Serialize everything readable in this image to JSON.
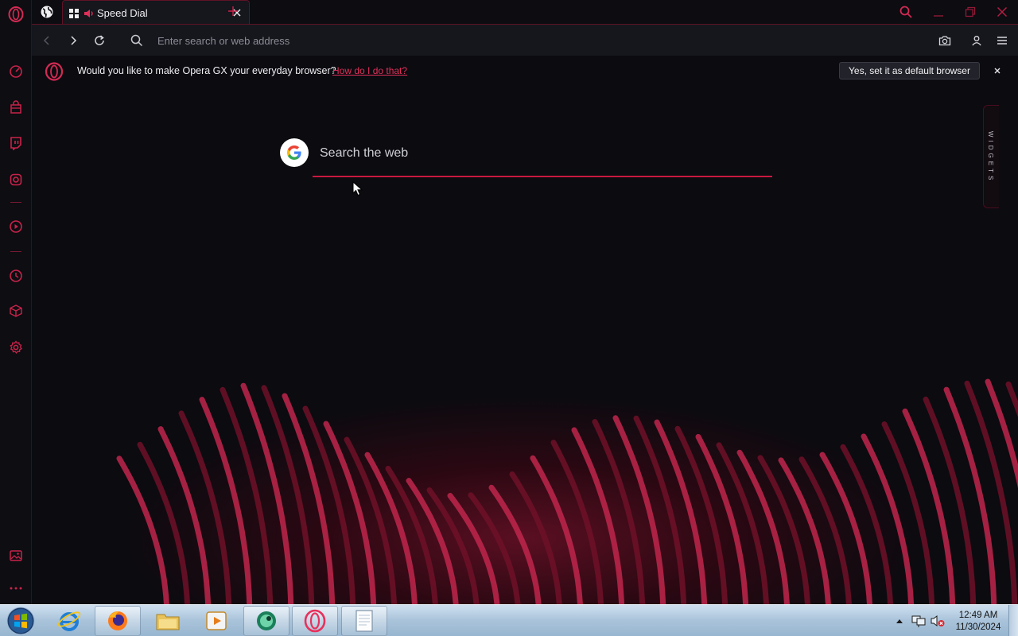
{
  "browser": {
    "tab": {
      "title": "Speed Dial"
    },
    "address_bar": {
      "placeholder": "Enter search or web address"
    }
  },
  "banner": {
    "message": "Would you like to make Opera GX your everyday browser?",
    "link": "How do I do that?",
    "button": "Yes, set it as default browser"
  },
  "speed_dial": {
    "search_placeholder": "Search the web",
    "widgets_label": "WIDGETS"
  },
  "sidebar": {
    "icons": [
      "opera-logo",
      "speedometer",
      "shopping-bag",
      "twitch",
      "instagram",
      "player",
      "history",
      "cube",
      "settings",
      "wallpaper",
      "more"
    ]
  },
  "taskbar": {
    "apps": [
      "internet-explorer",
      "firefox",
      "file-explorer",
      "media-player",
      "coccoc",
      "opera-gx",
      "notepad"
    ],
    "clock": {
      "time": "12:49 AM",
      "date": "11/30/2024"
    }
  },
  "colors": {
    "accent": "#e0305a",
    "background": "#0b0b10",
    "taskbar": "#a9c3da"
  }
}
